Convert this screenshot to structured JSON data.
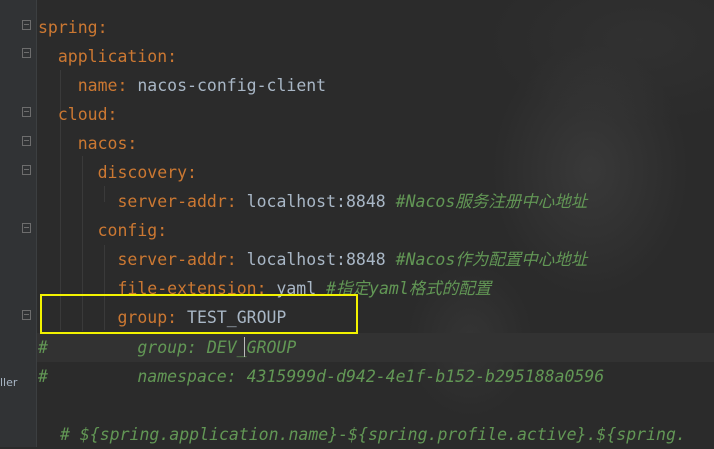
{
  "editor": {
    "lines": [
      {
        "indent": "",
        "key": "spring",
        "colon": ":",
        "value": "",
        "comment": ""
      },
      {
        "indent": "  ",
        "key": "application",
        "colon": ":",
        "value": "",
        "comment": ""
      },
      {
        "indent": "    ",
        "key": "name",
        "colon": ":",
        "value": " nacos-config-client",
        "comment": ""
      },
      {
        "indent": "  ",
        "key": "cloud",
        "colon": ":",
        "value": "",
        "comment": ""
      },
      {
        "indent": "    ",
        "key": "nacos",
        "colon": ":",
        "value": "",
        "comment": ""
      },
      {
        "indent": "      ",
        "key": "discovery",
        "colon": ":",
        "value": "",
        "comment": ""
      },
      {
        "indent": "        ",
        "key": "server-addr",
        "colon": ":",
        "value": " localhost:8848 ",
        "comment": "#Nacos服务注册中心地址"
      },
      {
        "indent": "      ",
        "key": "config",
        "colon": ":",
        "value": "",
        "comment": ""
      },
      {
        "indent": "        ",
        "key": "server-addr",
        "colon": ":",
        "value": " localhost:8848 ",
        "comment": "#Nacos作为配置中心地址"
      },
      {
        "indent": "        ",
        "key": "file-extension",
        "colon": ":",
        "value": " yaml ",
        "comment": "#指定yaml格式的配置"
      },
      {
        "indent": "        ",
        "key": "group",
        "colon": ":",
        "value": " TEST_GROUP",
        "comment": ""
      }
    ],
    "commented_lines": [
      "#         group: DEV_GROUP",
      "#         namespace: 4315999d-d942-4e1f-b152-b295188a0596"
    ],
    "bottom_comment": "# ${spring.application.name}-${spring.profile.active}.${spring.",
    "side_label": "ller"
  },
  "colors": {
    "background": "#2b2b2b",
    "key": "#cc7832",
    "text": "#a9b7c6",
    "comment": "#629755",
    "highlight_box": "#f2f200"
  }
}
